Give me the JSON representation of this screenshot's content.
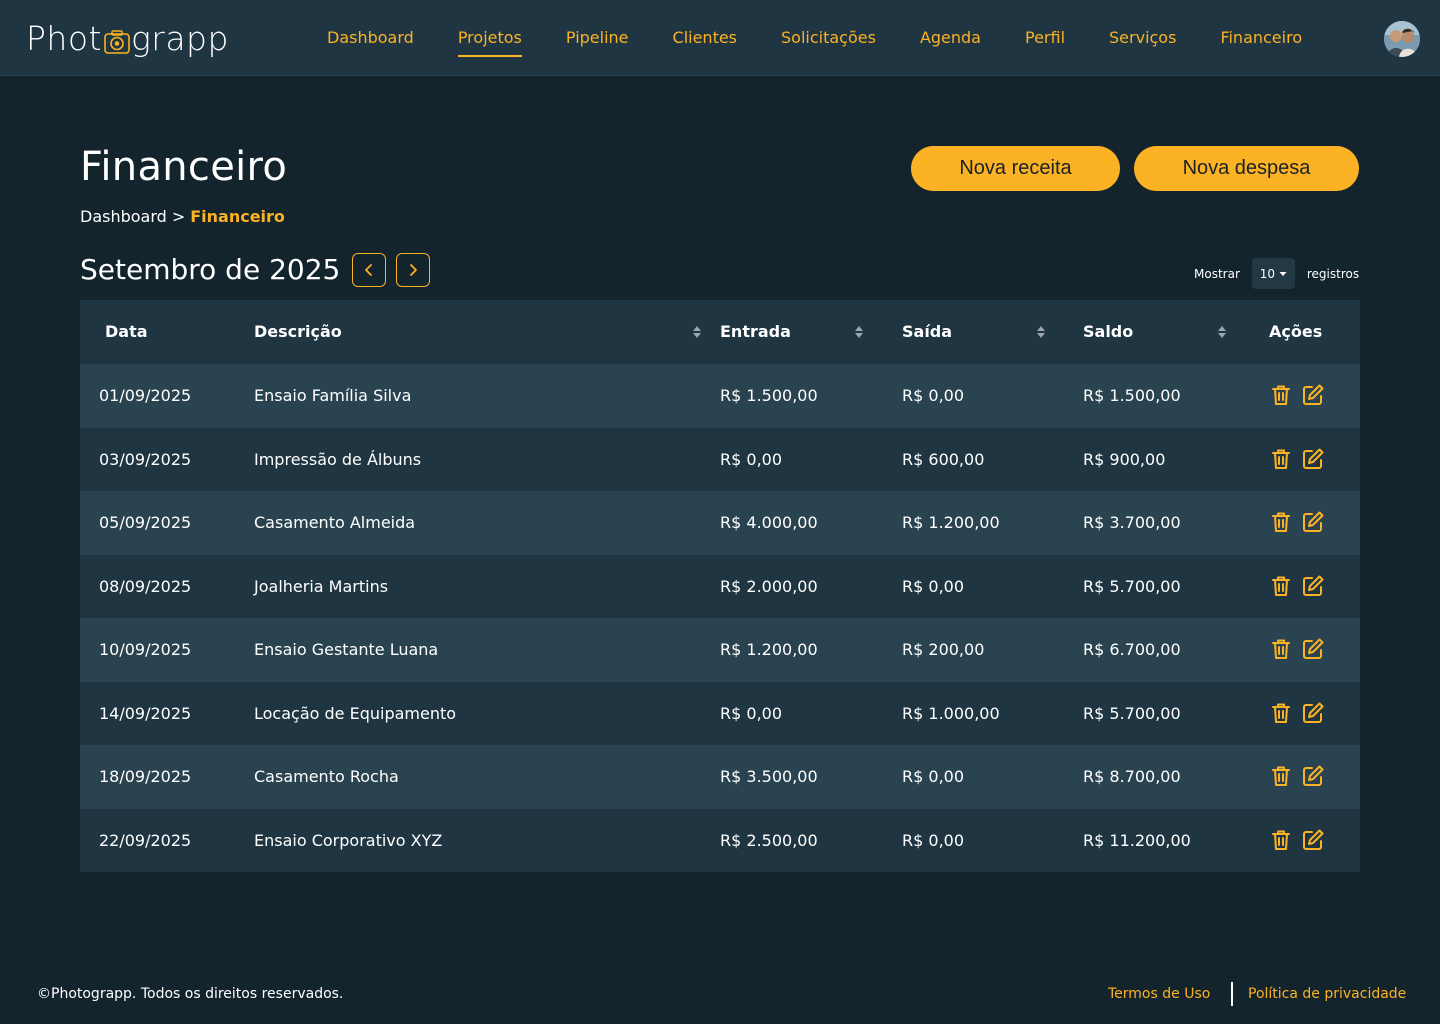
{
  "header": {
    "logo_text_left": "Phot",
    "logo_text_right": "grapp",
    "nav": [
      {
        "label": "Dashboard"
      },
      {
        "label": "Projetos"
      },
      {
        "label": "Pipeline"
      },
      {
        "label": "Clientes"
      },
      {
        "label": "Solicitações"
      },
      {
        "label": "Agenda"
      },
      {
        "label": "Perfil"
      },
      {
        "label": "Serviços"
      },
      {
        "label": "Financeiro"
      }
    ],
    "active_nav": "Projetos"
  },
  "page": {
    "title": "Financeiro",
    "breadcrumb_root": "Dashboard",
    "breadcrumb_sep": ">",
    "breadcrumb_current": "Financeiro",
    "btn_receita": "Nova receita",
    "btn_despesa": "Nova despesa",
    "month_label": "Setembro de 2025",
    "show_label": "Mostrar",
    "show_value": "10",
    "records_label": "registros"
  },
  "table": {
    "headers": {
      "data": "Data",
      "descricao": "Descrição",
      "entrada": "Entrada",
      "saida": "Saída",
      "saldo": "Saldo",
      "acoes": "Ações"
    },
    "rows": [
      {
        "data": "01/09/2025",
        "descricao": "Ensaio Família Silva",
        "entrada": "R$ 1.500,00",
        "saida": "R$ 0,00",
        "saldo": "R$ 1.500,00"
      },
      {
        "data": "03/09/2025",
        "descricao": "Impressão de Álbuns",
        "entrada": "R$ 0,00",
        "saida": "R$ 600,00",
        "saldo": "R$ 900,00"
      },
      {
        "data": "05/09/2025",
        "descricao": "Casamento Almeida",
        "entrada": "R$ 4.000,00",
        "saida": "R$ 1.200,00",
        "saldo": "R$ 3.700,00"
      },
      {
        "data": "08/09/2025",
        "descricao": "Joalheria Martins",
        "entrada": "R$ 2.000,00",
        "saida": "R$ 0,00",
        "saldo": "R$ 5.700,00"
      },
      {
        "data": "10/09/2025",
        "descricao": "Ensaio Gestante Luana",
        "entrada": "R$ 1.200,00",
        "saida": "R$ 200,00",
        "saldo": "R$ 6.700,00"
      },
      {
        "data": "14/09/2025",
        "descricao": "Locação de Equipamento",
        "entrada": "R$ 0,00",
        "saida": "R$ 1.000,00",
        "saldo": "R$ 5.700,00"
      },
      {
        "data": "18/09/2025",
        "descricao": "Casamento Rocha",
        "entrada": "R$ 3.500,00",
        "saida": "R$ 0,00",
        "saldo": "R$ 8.700,00"
      },
      {
        "data": "22/09/2025",
        "descricao": "Ensaio Corporativo XYZ",
        "entrada": "R$ 2.500,00",
        "saida": "R$ 0,00",
        "saldo": "R$ 11.200,00"
      }
    ]
  },
  "footer": {
    "copyright": "©Photograpp. Todos os direitos reservados.",
    "terms": "Termos de Uso",
    "privacy": "Política de privacidade"
  },
  "colors": {
    "accent": "#fbb225",
    "background": "#13242c",
    "header_bg": "#1f3642",
    "row_odd": "#2a4350",
    "row_even": "#1f3642"
  },
  "icons": {
    "logo": "camera-icon",
    "prev": "chevron-left-icon",
    "next": "chevron-right-icon",
    "select": "caret-down-icon",
    "sort": "sort-icon",
    "delete": "trash-icon",
    "edit": "edit-icon"
  }
}
